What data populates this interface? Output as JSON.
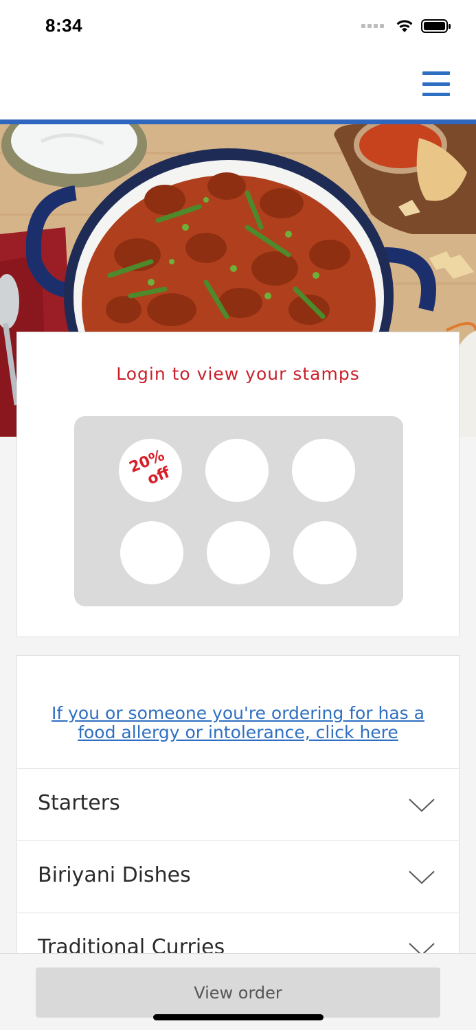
{
  "status_bar": {
    "time": "8:34",
    "icons": [
      "signal-icon",
      "wifi-icon",
      "battery-icon"
    ]
  },
  "header": {
    "menu_icon": "hamburger-menu-icon",
    "accent_color": "#2f67bf"
  },
  "hero": {
    "image": "curry-dish-hero-image"
  },
  "stamps": {
    "title": "Login to view your stamps",
    "title_color": "#c8202a",
    "total_stamps": 6,
    "reward_line1": "20%",
    "reward_line2": "off"
  },
  "menu": {
    "allergy_link": "If you or someone you're ordering for has a food allergy or intolerance, click here",
    "categories": [
      {
        "label": "Starters"
      },
      {
        "label": "Biriyani Dishes"
      },
      {
        "label": "Traditional Curries"
      }
    ]
  },
  "bottom": {
    "view_order_label": "View order"
  }
}
